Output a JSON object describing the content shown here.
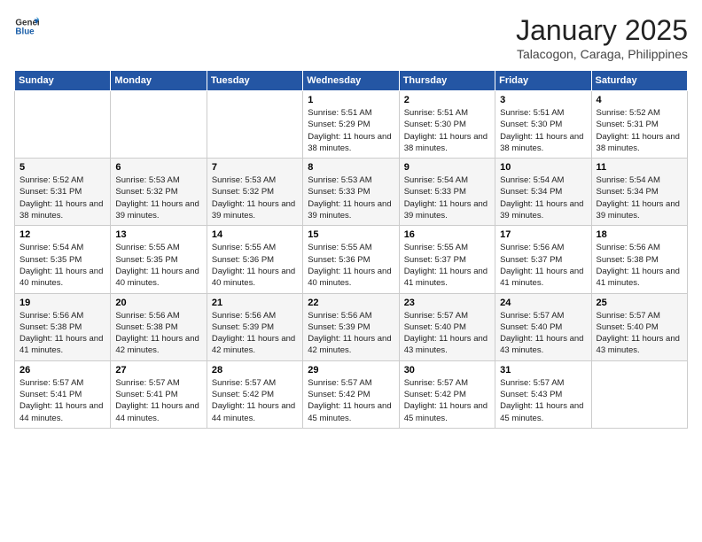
{
  "logo": {
    "text_general": "General",
    "text_blue": "Blue"
  },
  "title": "January 2025",
  "subtitle": "Talacogon, Caraga, Philippines",
  "days_of_week": [
    "Sunday",
    "Monday",
    "Tuesday",
    "Wednesday",
    "Thursday",
    "Friday",
    "Saturday"
  ],
  "weeks": [
    [
      {
        "day": "",
        "info": ""
      },
      {
        "day": "",
        "info": ""
      },
      {
        "day": "",
        "info": ""
      },
      {
        "day": "1",
        "info": "Sunrise: 5:51 AM\nSunset: 5:29 PM\nDaylight: 11 hours and 38 minutes."
      },
      {
        "day": "2",
        "info": "Sunrise: 5:51 AM\nSunset: 5:30 PM\nDaylight: 11 hours and 38 minutes."
      },
      {
        "day": "3",
        "info": "Sunrise: 5:51 AM\nSunset: 5:30 PM\nDaylight: 11 hours and 38 minutes."
      },
      {
        "day": "4",
        "info": "Sunrise: 5:52 AM\nSunset: 5:31 PM\nDaylight: 11 hours and 38 minutes."
      }
    ],
    [
      {
        "day": "5",
        "info": "Sunrise: 5:52 AM\nSunset: 5:31 PM\nDaylight: 11 hours and 38 minutes."
      },
      {
        "day": "6",
        "info": "Sunrise: 5:53 AM\nSunset: 5:32 PM\nDaylight: 11 hours and 39 minutes."
      },
      {
        "day": "7",
        "info": "Sunrise: 5:53 AM\nSunset: 5:32 PM\nDaylight: 11 hours and 39 minutes."
      },
      {
        "day": "8",
        "info": "Sunrise: 5:53 AM\nSunset: 5:33 PM\nDaylight: 11 hours and 39 minutes."
      },
      {
        "day": "9",
        "info": "Sunrise: 5:54 AM\nSunset: 5:33 PM\nDaylight: 11 hours and 39 minutes."
      },
      {
        "day": "10",
        "info": "Sunrise: 5:54 AM\nSunset: 5:34 PM\nDaylight: 11 hours and 39 minutes."
      },
      {
        "day": "11",
        "info": "Sunrise: 5:54 AM\nSunset: 5:34 PM\nDaylight: 11 hours and 39 minutes."
      }
    ],
    [
      {
        "day": "12",
        "info": "Sunrise: 5:54 AM\nSunset: 5:35 PM\nDaylight: 11 hours and 40 minutes."
      },
      {
        "day": "13",
        "info": "Sunrise: 5:55 AM\nSunset: 5:35 PM\nDaylight: 11 hours and 40 minutes."
      },
      {
        "day": "14",
        "info": "Sunrise: 5:55 AM\nSunset: 5:36 PM\nDaylight: 11 hours and 40 minutes."
      },
      {
        "day": "15",
        "info": "Sunrise: 5:55 AM\nSunset: 5:36 PM\nDaylight: 11 hours and 40 minutes."
      },
      {
        "day": "16",
        "info": "Sunrise: 5:55 AM\nSunset: 5:37 PM\nDaylight: 11 hours and 41 minutes."
      },
      {
        "day": "17",
        "info": "Sunrise: 5:56 AM\nSunset: 5:37 PM\nDaylight: 11 hours and 41 minutes."
      },
      {
        "day": "18",
        "info": "Sunrise: 5:56 AM\nSunset: 5:38 PM\nDaylight: 11 hours and 41 minutes."
      }
    ],
    [
      {
        "day": "19",
        "info": "Sunrise: 5:56 AM\nSunset: 5:38 PM\nDaylight: 11 hours and 41 minutes."
      },
      {
        "day": "20",
        "info": "Sunrise: 5:56 AM\nSunset: 5:38 PM\nDaylight: 11 hours and 42 minutes."
      },
      {
        "day": "21",
        "info": "Sunrise: 5:56 AM\nSunset: 5:39 PM\nDaylight: 11 hours and 42 minutes."
      },
      {
        "day": "22",
        "info": "Sunrise: 5:56 AM\nSunset: 5:39 PM\nDaylight: 11 hours and 42 minutes."
      },
      {
        "day": "23",
        "info": "Sunrise: 5:57 AM\nSunset: 5:40 PM\nDaylight: 11 hours and 43 minutes."
      },
      {
        "day": "24",
        "info": "Sunrise: 5:57 AM\nSunset: 5:40 PM\nDaylight: 11 hours and 43 minutes."
      },
      {
        "day": "25",
        "info": "Sunrise: 5:57 AM\nSunset: 5:40 PM\nDaylight: 11 hours and 43 minutes."
      }
    ],
    [
      {
        "day": "26",
        "info": "Sunrise: 5:57 AM\nSunset: 5:41 PM\nDaylight: 11 hours and 44 minutes."
      },
      {
        "day": "27",
        "info": "Sunrise: 5:57 AM\nSunset: 5:41 PM\nDaylight: 11 hours and 44 minutes."
      },
      {
        "day": "28",
        "info": "Sunrise: 5:57 AM\nSunset: 5:42 PM\nDaylight: 11 hours and 44 minutes."
      },
      {
        "day": "29",
        "info": "Sunrise: 5:57 AM\nSunset: 5:42 PM\nDaylight: 11 hours and 45 minutes."
      },
      {
        "day": "30",
        "info": "Sunrise: 5:57 AM\nSunset: 5:42 PM\nDaylight: 11 hours and 45 minutes."
      },
      {
        "day": "31",
        "info": "Sunrise: 5:57 AM\nSunset: 5:43 PM\nDaylight: 11 hours and 45 minutes."
      },
      {
        "day": "",
        "info": ""
      }
    ]
  ]
}
